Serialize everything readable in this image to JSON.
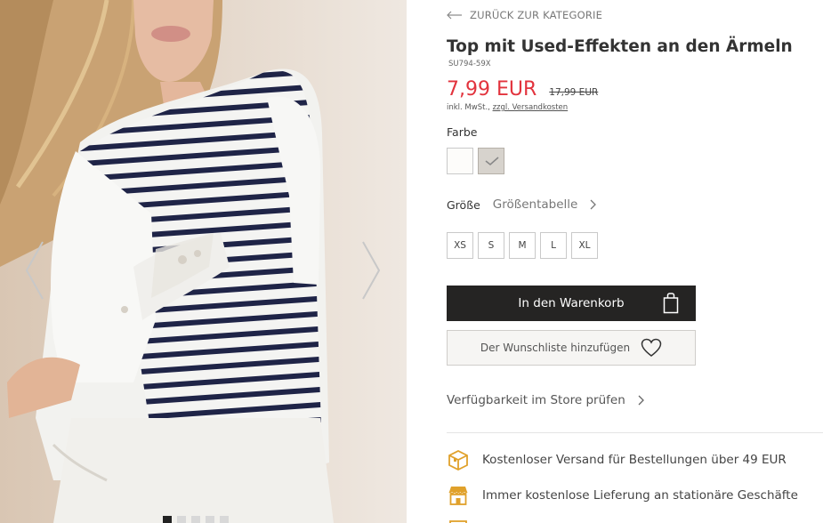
{
  "gallery": {
    "dots_count": 5,
    "active_dot": 0
  },
  "product": {
    "back_label": "ZURÜCK ZUR KATEGORIE",
    "title": "Top mit Used-Effekten an den Ärmeln",
    "sku": "SU794-59X",
    "price": "7,99 EUR",
    "old_price": "17,99 EUR",
    "tax_prefix": "inkl. MwSt., ",
    "shipping_link": "zzgl. Versandkosten",
    "color_label": "Farbe",
    "colors": [
      {
        "name": "weiss",
        "hex": "#fdfcfa",
        "selected": false
      },
      {
        "name": "grau",
        "hex": "#d7d3cd",
        "selected": true
      }
    ],
    "size_label": "Größe",
    "size_chart_label": "Größentabelle",
    "sizes": [
      "XS",
      "S",
      "M",
      "L",
      "XL"
    ],
    "cart_label": "In den Warenkorb",
    "wishlist_label": "Der Wunschliste hinzufügen",
    "store_check_label": "Verfügbarkeit im Store prüfen"
  },
  "perks": [
    {
      "icon": "delivery-box-icon",
      "text": "Kostenloser Versand für Bestellungen über 49 EUR"
    },
    {
      "icon": "store-icon",
      "text": "Immer kostenlose Lieferung an stationäre Geschäfte"
    }
  ],
  "colors": {
    "accent_price": "#e2333d",
    "button_dark": "#252423",
    "perk_icon": "#e0a12b"
  }
}
